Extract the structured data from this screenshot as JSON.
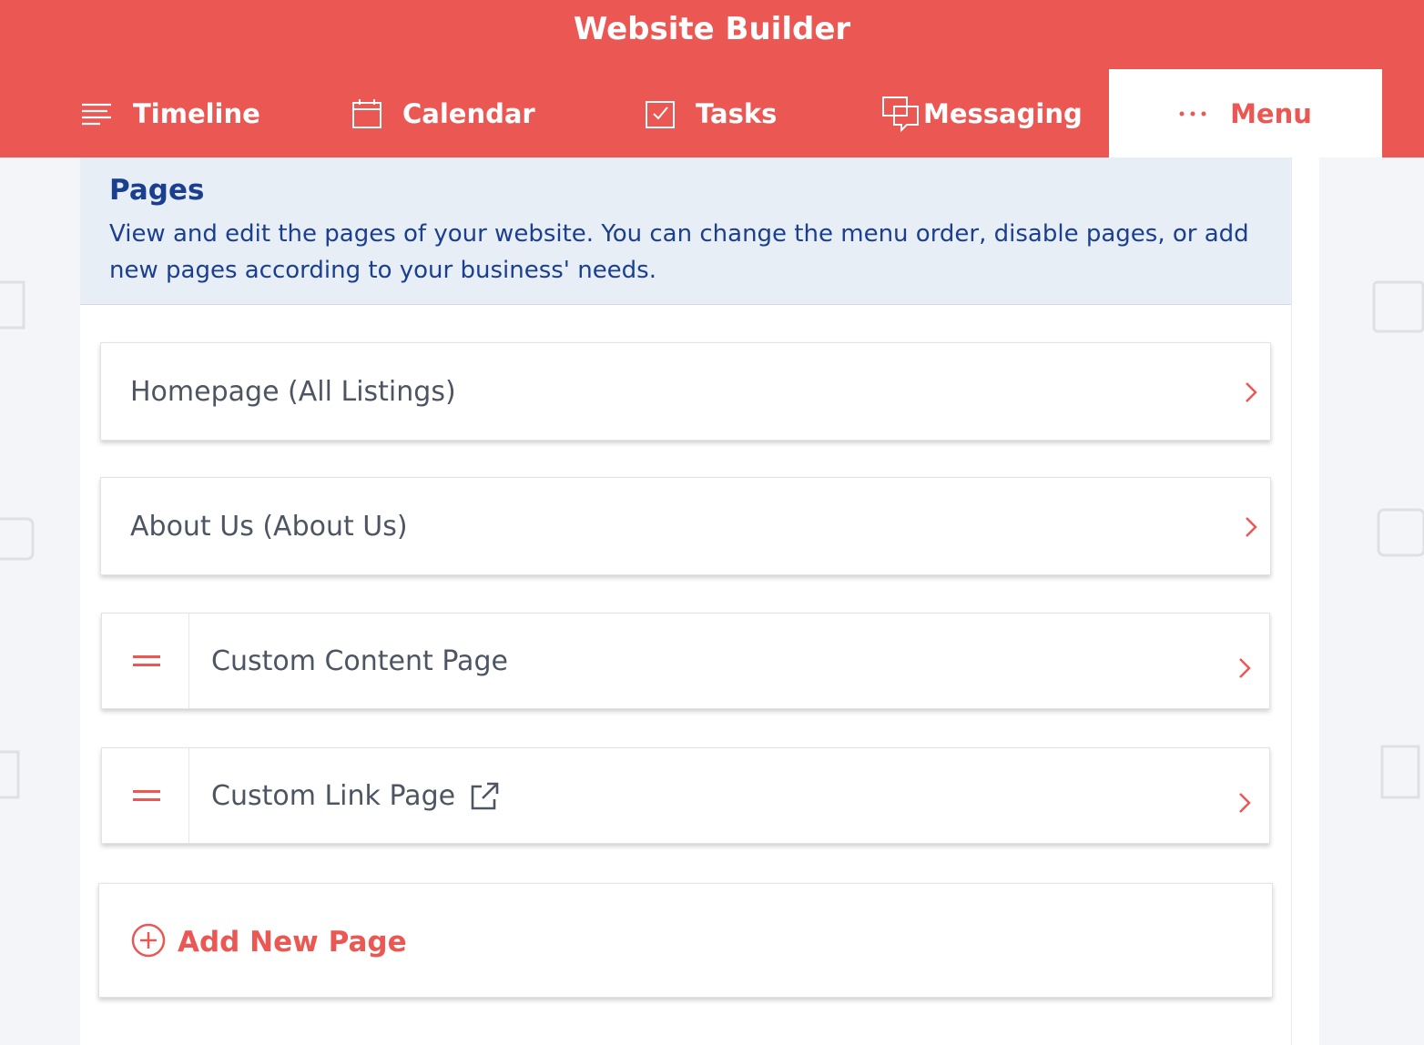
{
  "app": {
    "title": "Website Builder"
  },
  "nav": {
    "tabs": [
      {
        "label": "Timeline",
        "icon": "timeline-icon",
        "active": false
      },
      {
        "label": "Calendar",
        "icon": "calendar-icon",
        "active": false
      },
      {
        "label": "Tasks",
        "icon": "tasks-icon",
        "active": false
      },
      {
        "label": "Messaging",
        "icon": "messaging-icon",
        "active": false
      },
      {
        "label": "Menu",
        "icon": "more-dots-icon",
        "active": true
      }
    ]
  },
  "pages_section": {
    "title": "Pages",
    "description": "View and edit the pages of your website. You can change the menu order, disable pages, or add new pages according to your business' needs.",
    "pages": [
      {
        "label": "Homepage (All Listings)",
        "draggable": false,
        "external_link": false
      },
      {
        "label": "About Us (About Us)",
        "draggable": false,
        "external_link": false
      },
      {
        "label": "Custom Content Page",
        "draggable": true,
        "external_link": false
      },
      {
        "label": "Custom Link Page",
        "draggable": true,
        "external_link": true
      }
    ],
    "add_button_label": "Add New Page"
  },
  "colors": {
    "accent": "#eb5753",
    "info_background": "#e8eef6",
    "info_text": "#1b3f8f",
    "card_text": "#4d5563"
  }
}
